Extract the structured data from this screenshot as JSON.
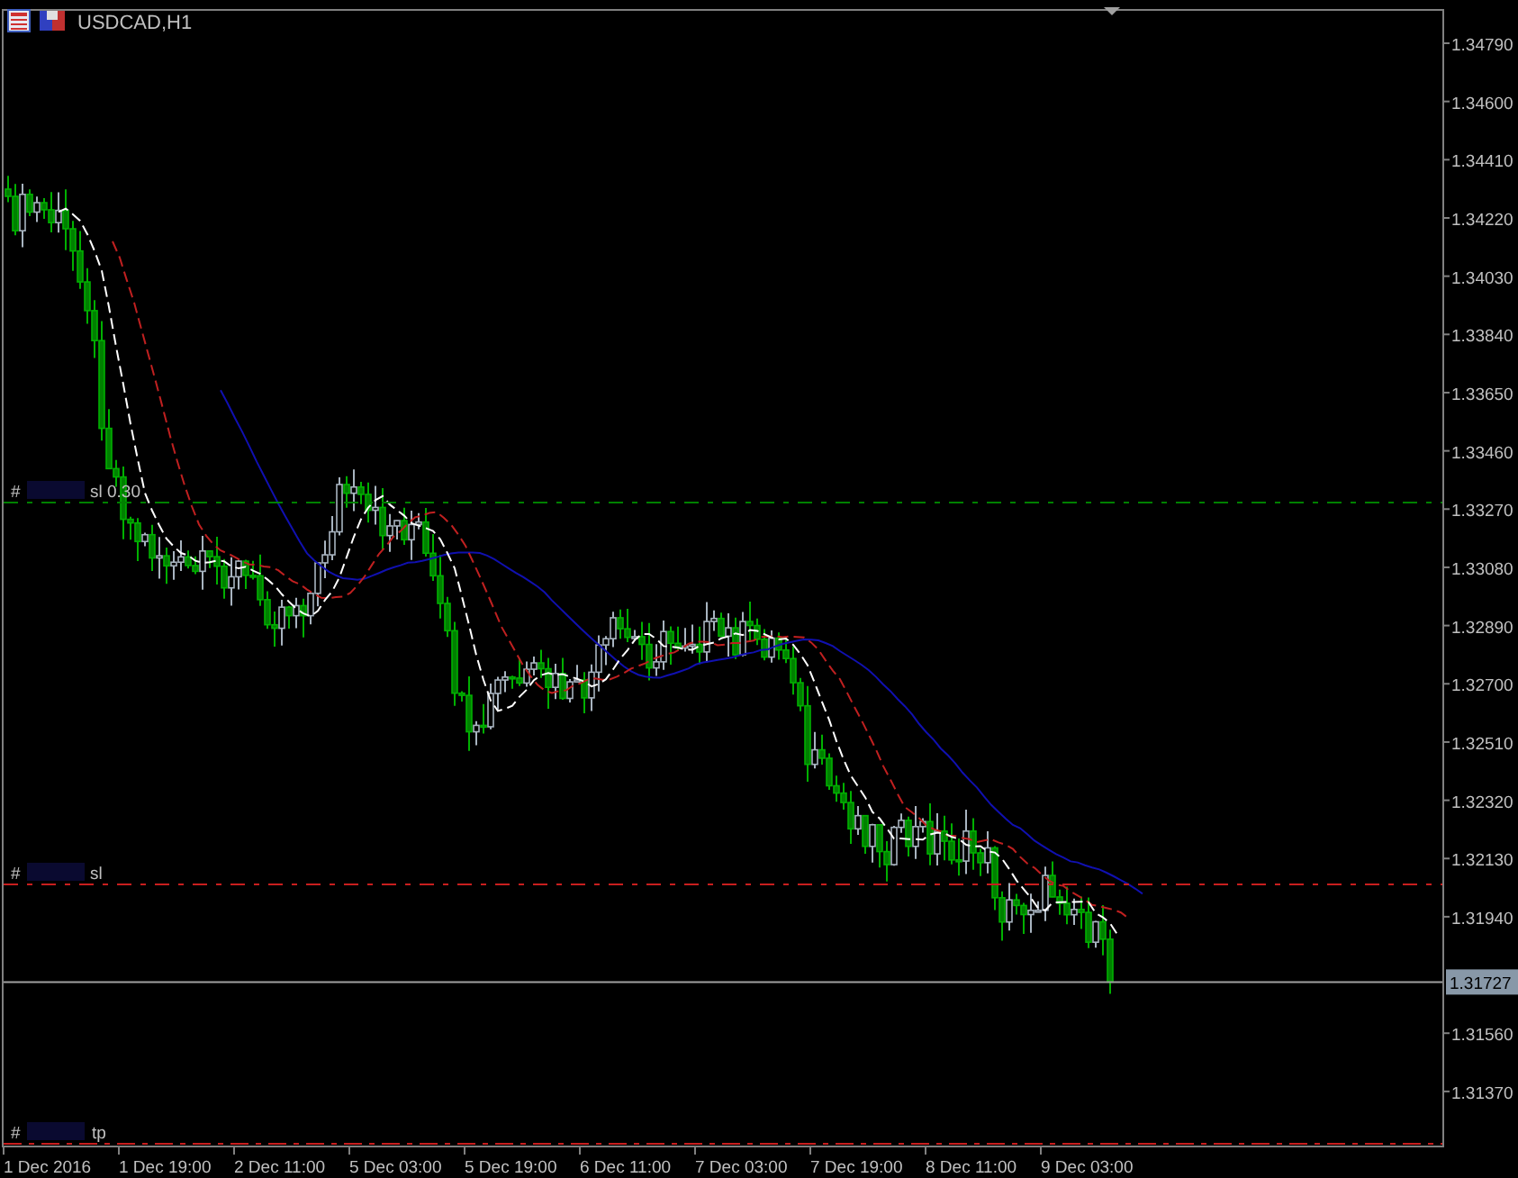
{
  "chart": {
    "title": "USDCAD,H1",
    "price_axis": [
      "1.34790",
      "1.34600",
      "1.34410",
      "1.34220",
      "1.34030",
      "1.33840",
      "1.33650",
      "1.33460",
      "1.33270",
      "1.33080",
      "1.32890",
      "1.32700",
      "1.32510",
      "1.32320",
      "1.32130",
      "1.31940",
      "1.31560",
      "1.31370"
    ],
    "current_price": "1.31727",
    "time_axis": [
      "1 Dec 2016",
      "1 Dec 19:00",
      "2 Dec 11:00",
      "5 Dec 03:00",
      "5 Dec 19:00",
      "6 Dec 11:00",
      "7 Dec 03:00",
      "7 Dec 19:00",
      "8 Dec 11:00",
      "9 Dec 03:00"
    ],
    "levels": [
      {
        "kind": "sl",
        "prefix": "#",
        "tag": "sl 0.30",
        "color": "#008000"
      },
      {
        "kind": "sl",
        "prefix": "#",
        "tag": "sl",
        "color": "#c81e1e"
      },
      {
        "kind": "tp",
        "prefix": "#",
        "tag": "tp",
        "color": "#c81e1e"
      }
    ]
  }
}
